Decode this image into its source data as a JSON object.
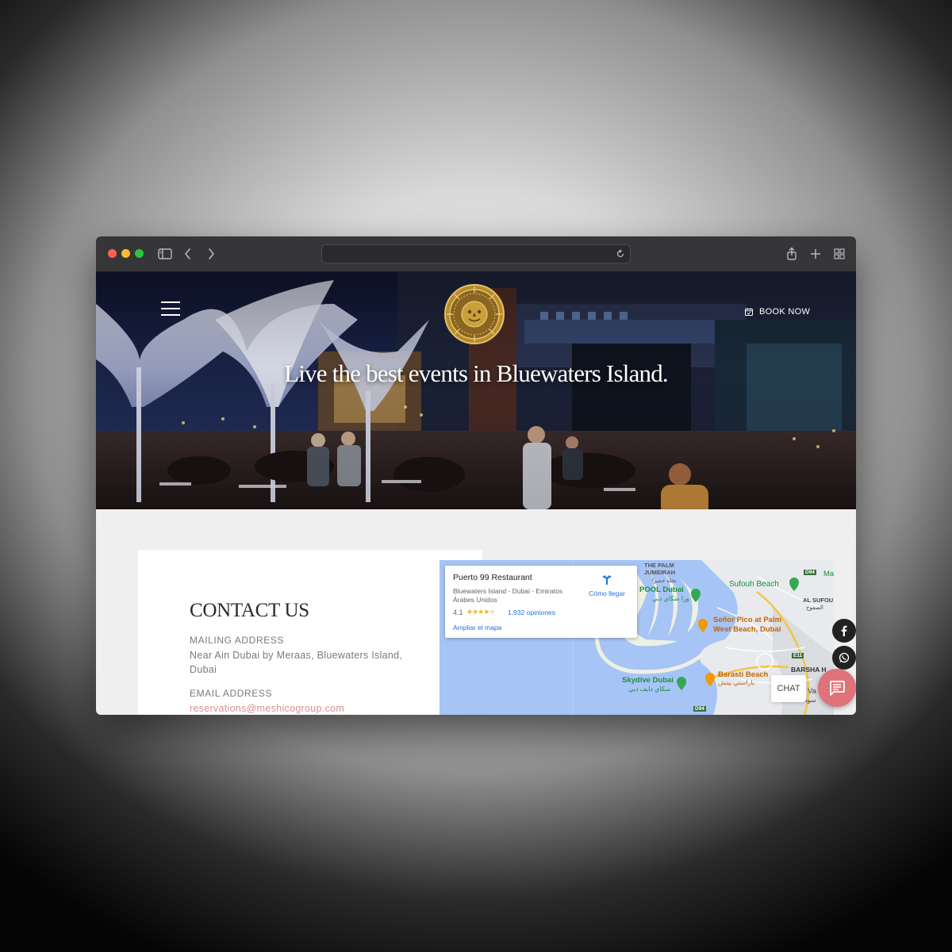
{
  "browser": {
    "url": ""
  },
  "hero": {
    "title": "Live the best events in Bluewaters Island.",
    "book_label": "BOOK NOW",
    "logo_text": "PUERTO 99"
  },
  "contact": {
    "title": "CONTACT US",
    "mailing_label": "MAILING ADDRESS",
    "mailing_value": "Near Ain Dubai by Meraas, Bluewaters Island, Dubai",
    "email_label": "EMAIL ADDRESS",
    "email_value": "reservations@meshicogroup.com"
  },
  "map": {
    "place_name": "Puerto 99 Restaurant",
    "place_address": "Bluewaters Island - Dubai - Emiratos Árabes Unidos",
    "rating": "4.1",
    "rating_stars": 4.1,
    "stars_text": "★★★★★",
    "reviews": "1,932 opiniones",
    "enlarge_label": "Ampliar el mapa",
    "directions_label": "Cómo llegar",
    "labels": {
      "palm": "THE PALM\nJUMEIRAH",
      "palm_arabic": "نخلة جميرا",
      "pool": "POOL Dubai",
      "pool_arabic": "ورا شكاي دبي",
      "sufouh_beach": "Sufouh Beach",
      "al_sufouh": "AL SUFOU",
      "al_sufouh_arabic": "الصفوح",
      "senor_pico": "Señor Pico at Palm",
      "west_beach": "West Beach, Dubai",
      "e11": "E11",
      "barasti": "Barasti Beach",
      "barasti_arabic": "باراستي بيتش",
      "skydive": "Skydive Dubai",
      "skydive_arabic": "سكاي دايف دبي",
      "barsha": "BARSHA H",
      "d94_top": "D94",
      "d94_bottom": "D94",
      "ma": "Ma",
      "va": "Va",
      "sud": "سود"
    }
  },
  "widgets": {
    "chat_label": "CHAT"
  },
  "colors": {
    "accent_chat": "#e0727a",
    "email_link": "#d98e8e",
    "map_water": "#a6c4f5",
    "logo_gold": "#c9a03a"
  }
}
